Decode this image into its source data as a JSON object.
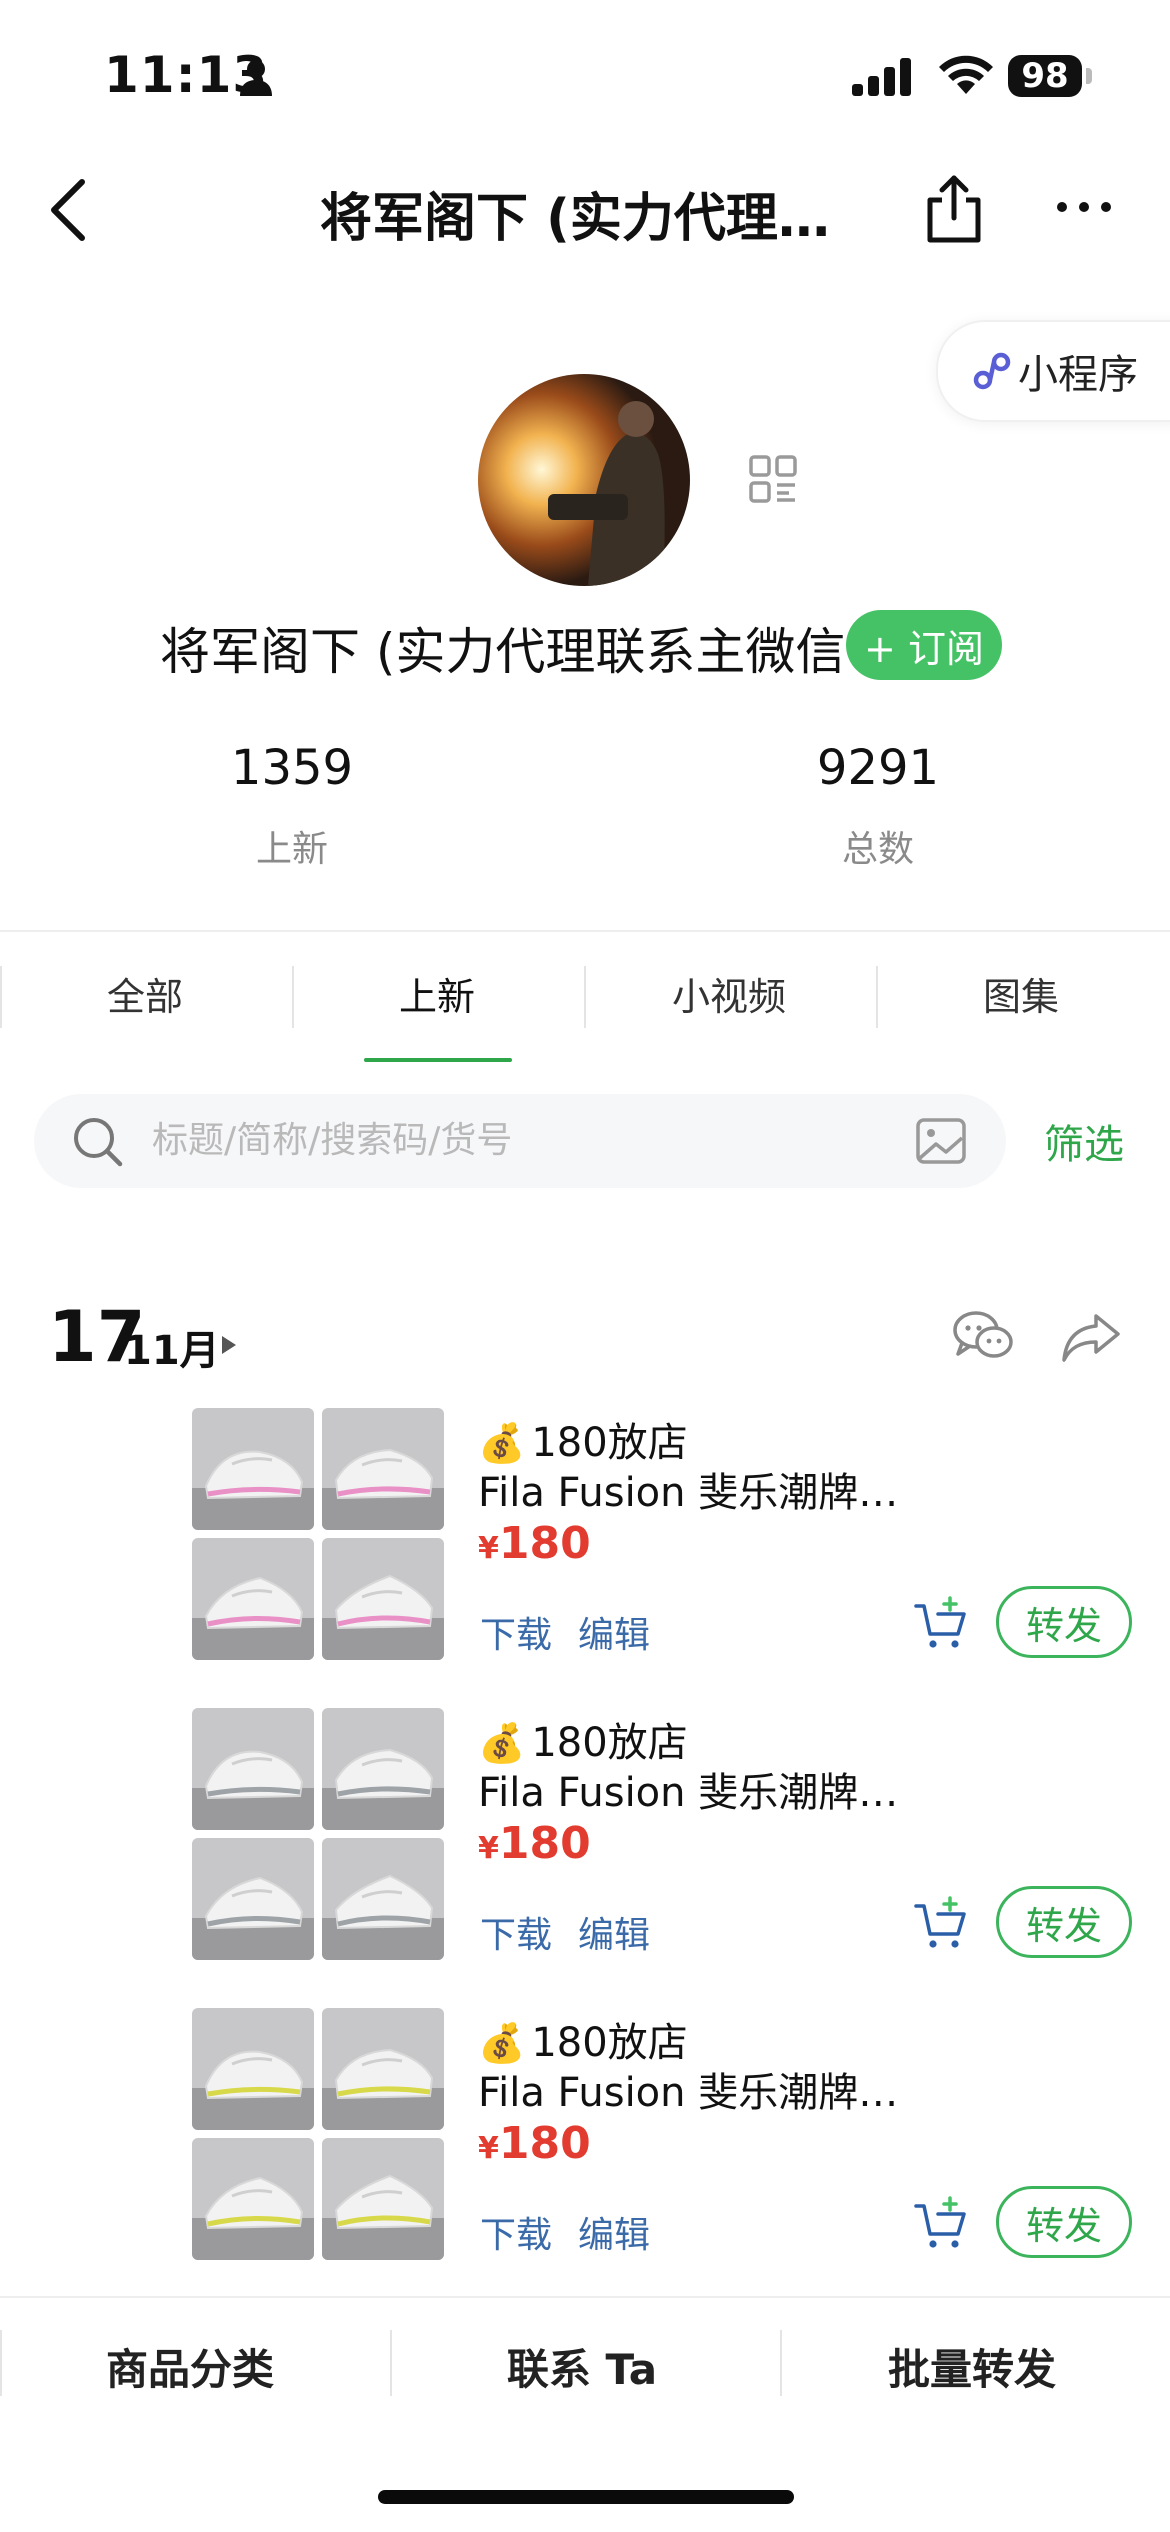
{
  "status_bar": {
    "time": "11:13",
    "battery": "98"
  },
  "nav": {
    "title": "将军阁下 (实力代理…"
  },
  "mini_program": {
    "label": "小程序"
  },
  "profile": {
    "name": "将军阁下 (实力代理联系主微信",
    "subscribe_label": "+ 订阅",
    "stats": [
      {
        "value": "1359",
        "label": "上新"
      },
      {
        "value": "9291",
        "label": "总数"
      }
    ]
  },
  "tabs": [
    {
      "label": "全部"
    },
    {
      "label": "上新"
    },
    {
      "label": "小视频"
    },
    {
      "label": "图集"
    }
  ],
  "active_tab": "上新",
  "search": {
    "placeholder": "标题/简称/搜索码/货号",
    "filter_label": "筛选"
  },
  "date_header": {
    "day": "17",
    "month": "11月"
  },
  "products": [
    {
      "price_tag_emoji": "💰",
      "price_tag": "180放店",
      "title": "Fila Fusion 斐乐潮牌…",
      "currency": "¥",
      "price": "180",
      "download_label": "下载",
      "edit_label": "编辑",
      "forward_label": "转发",
      "accent": "#e991c6"
    },
    {
      "price_tag_emoji": "💰",
      "price_tag": "180放店",
      "title": "Fila Fusion 斐乐潮牌…",
      "currency": "¥",
      "price": "180",
      "download_label": "下载",
      "edit_label": "编辑",
      "forward_label": "转发",
      "accent": "#9ea3a8"
    },
    {
      "price_tag_emoji": "💰",
      "price_tag": "180放店",
      "title": "Fila Fusion 斐乐潮牌…",
      "currency": "¥",
      "price": "180",
      "download_label": "下载",
      "edit_label": "编辑",
      "forward_label": "转发",
      "accent": "#d8d94a"
    }
  ],
  "bottom_bar": [
    {
      "label": "商品分类"
    },
    {
      "label": "联系 Ta"
    },
    {
      "label": "批量转发"
    }
  ],
  "colors": {
    "brand_green": "#45c266",
    "price_red": "#e23b2f",
    "link_blue": "#3b6aa8"
  }
}
